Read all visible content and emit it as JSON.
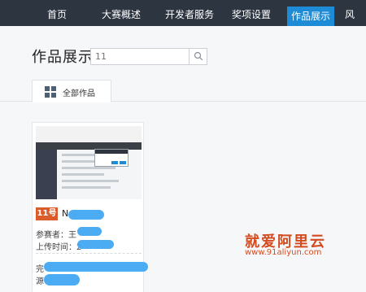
{
  "nav": {
    "items": [
      {
        "label": "首页"
      },
      {
        "label": "大赛概述"
      },
      {
        "label": "开发者服务"
      },
      {
        "label": "奖项设置"
      },
      {
        "label": "作品展示",
        "active": true
      },
      {
        "label": "风"
      }
    ]
  },
  "page": {
    "title": "作品展示",
    "search_value": "11",
    "tab_label": "全部作品"
  },
  "card": {
    "badge": "11号",
    "title_visible": "N",
    "participant_label": "参赛者：",
    "participant_visible": "王",
    "upload_label": "上传时间：",
    "upload_visible": "2",
    "desc_prefix": "完",
    "source_prefix": "源"
  },
  "watermark": {
    "cn": "就爱阿里云",
    "url": "www.91aliyun.com"
  },
  "colors": {
    "nav_bg": "#2d3541",
    "nav_active": "#1d8bd6",
    "badge": "#dc5b2a",
    "blur": "#41a7f2",
    "watermark": "#d44b1f"
  }
}
